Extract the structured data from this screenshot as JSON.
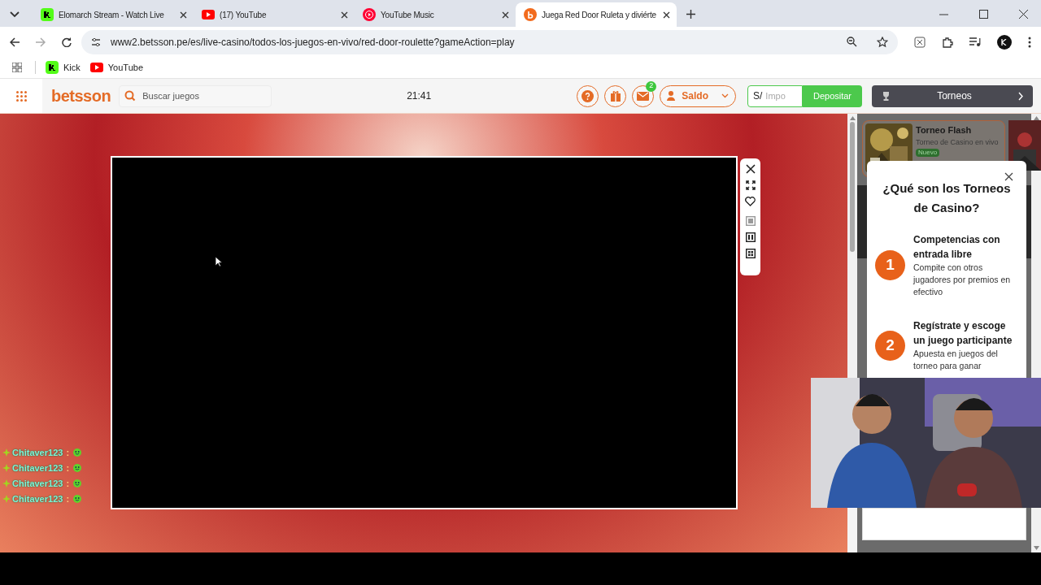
{
  "browser": {
    "tabs": [
      {
        "title": "Elomarch Stream - Watch Live",
        "selected": false
      },
      {
        "title": "(17) YouTube",
        "selected": false
      },
      {
        "title": "YouTube Music",
        "selected": false
      },
      {
        "title": "Juega Red Door Ruleta y diviérte",
        "selected": true
      }
    ],
    "url": "www2.betsson.pe/es/live-casino/todos-los-juegos-en-vivo/red-door-roulette?gameAction=play",
    "bookmarks": [
      {
        "label": "Kick"
      },
      {
        "label": "YouTube"
      }
    ]
  },
  "header": {
    "logo": "betsson",
    "search": {
      "placeholder": "Buscar juegos"
    },
    "time": "21:41",
    "mail_badge": "2",
    "balance_button": "Saldo",
    "amount_prefix": "S/",
    "amount": {
      "placeholder": "Impo"
    },
    "deposit_button": "Depositar",
    "tournaments_button": "Torneos"
  },
  "chat": [
    {
      "user": "Chitaver123",
      "sep": ":"
    },
    {
      "user": "Chitaver123",
      "sep": ":"
    },
    {
      "user": "Chitaver123",
      "sep": ":"
    },
    {
      "user": "Chitaver123",
      "sep": ":"
    }
  ],
  "tournament_card": {
    "title": "Torneo Flash",
    "subtitle": "Torneo de Casino en vivo",
    "badge": "Nuevo"
  },
  "modal": {
    "title": "¿Qué son los Torneos de Casino?",
    "steps": [
      {
        "number": "1",
        "title": "Competencias con entrada libre",
        "text": "Compite con otros jugadores por premios en efectivo"
      },
      {
        "number": "2",
        "title": "Regístrate y escoge un juego participante",
        "text": "Apuesta en juegos del torneo para ganar"
      }
    ]
  }
}
